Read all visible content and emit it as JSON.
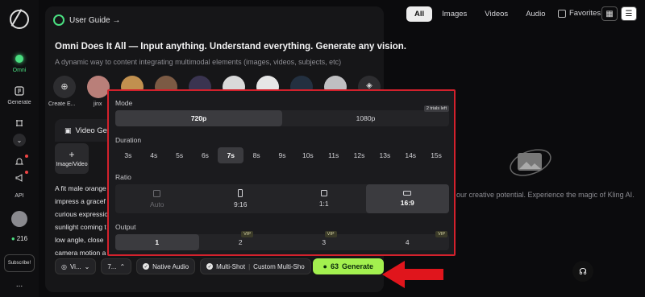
{
  "rail": {
    "omni_label": "Omni",
    "generate_label": "Generate",
    "api_label": "API",
    "credits": "216",
    "subscribe_label": "Subscribe!",
    "more": "..."
  },
  "panel": {
    "guide_label": "User Guide →",
    "headline": "Omni Does It All — Input anything. Understand everything. Generate any vision.",
    "subline": "A dynamic way to content integrating multimodal elements (images, videos, subjects, etc)",
    "avatars": [
      {
        "label": "Create E...",
        "icon": "add-element-icon"
      },
      {
        "label": "jinx"
      }
    ],
    "video_tab_label": "Video Ge",
    "image_video_label": "Image/Video",
    "image_video_plus": "+",
    "prompt_lines": [
      "A fit male orange",
      "impress a gracef",
      "curious expressio",
      "sunlight coming t",
      "low angle, close",
      "camera motion a"
    ]
  },
  "bottom_bar": {
    "mode_chip": "Vi...",
    "duration_chip": "7...",
    "native_audio": "Native Audio",
    "multi_shot": "Multi-Shot",
    "custom_multi": "Custom Multi-Sho",
    "generate_cost": "63",
    "generate_label": "Generate"
  },
  "filters": {
    "items": [
      "All",
      "Images",
      "Videos",
      "Audio"
    ],
    "active": "All",
    "favorites_label": "Favorites"
  },
  "empty_state": {
    "text": "our creative potential. Experience the magic of Kling AI."
  },
  "settings": {
    "mode_label": "Mode",
    "mode_options": [
      "720p",
      "1080p"
    ],
    "mode_selected": "720p",
    "trials_badge": "2 trials left",
    "duration_label": "Duration",
    "durations": [
      "3s",
      "4s",
      "5s",
      "6s",
      "7s",
      "8s",
      "9s",
      "10s",
      "11s",
      "12s",
      "13s",
      "14s",
      "15s"
    ],
    "duration_selected": "7s",
    "ratio_label": "Ratio",
    "ratios": [
      "Auto",
      "9:16",
      "1:1",
      "16:9"
    ],
    "ratio_selected": "16:9",
    "output_label": "Output",
    "outputs": [
      "1",
      "2",
      "3",
      "4"
    ],
    "output_selected": "1",
    "vip_label": "VIP"
  },
  "colors": {
    "accent_green": "#a3f04f",
    "highlight_red": "#d3212c",
    "arrow_red": "#e0151c"
  }
}
